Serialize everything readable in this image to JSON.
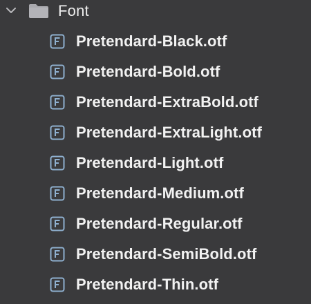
{
  "folder": {
    "name": "Font",
    "icon": "folder-icon",
    "expanded": true,
    "chevron_icon": "chevron-down-icon"
  },
  "files": [
    {
      "label": "Pretendard-Black.otf",
      "icon": "font-file-icon"
    },
    {
      "label": "Pretendard-Bold.otf",
      "icon": "font-file-icon"
    },
    {
      "label": "Pretendard-ExtraBold.otf",
      "icon": "font-file-icon"
    },
    {
      "label": "Pretendard-ExtraLight.otf",
      "icon": "font-file-icon"
    },
    {
      "label": "Pretendard-Light.otf",
      "icon": "font-file-icon"
    },
    {
      "label": "Pretendard-Medium.otf",
      "icon": "font-file-icon"
    },
    {
      "label": "Pretendard-Regular.otf",
      "icon": "font-file-icon"
    },
    {
      "label": "Pretendard-SemiBold.otf",
      "icon": "font-file-icon"
    },
    {
      "label": "Pretendard-Thin.otf",
      "icon": "font-file-icon"
    }
  ],
  "colors": {
    "background": "#3a3a3c",
    "text": "#f2f2f2",
    "icon": "#8fb0cf",
    "folder": "#a9a9ae"
  }
}
